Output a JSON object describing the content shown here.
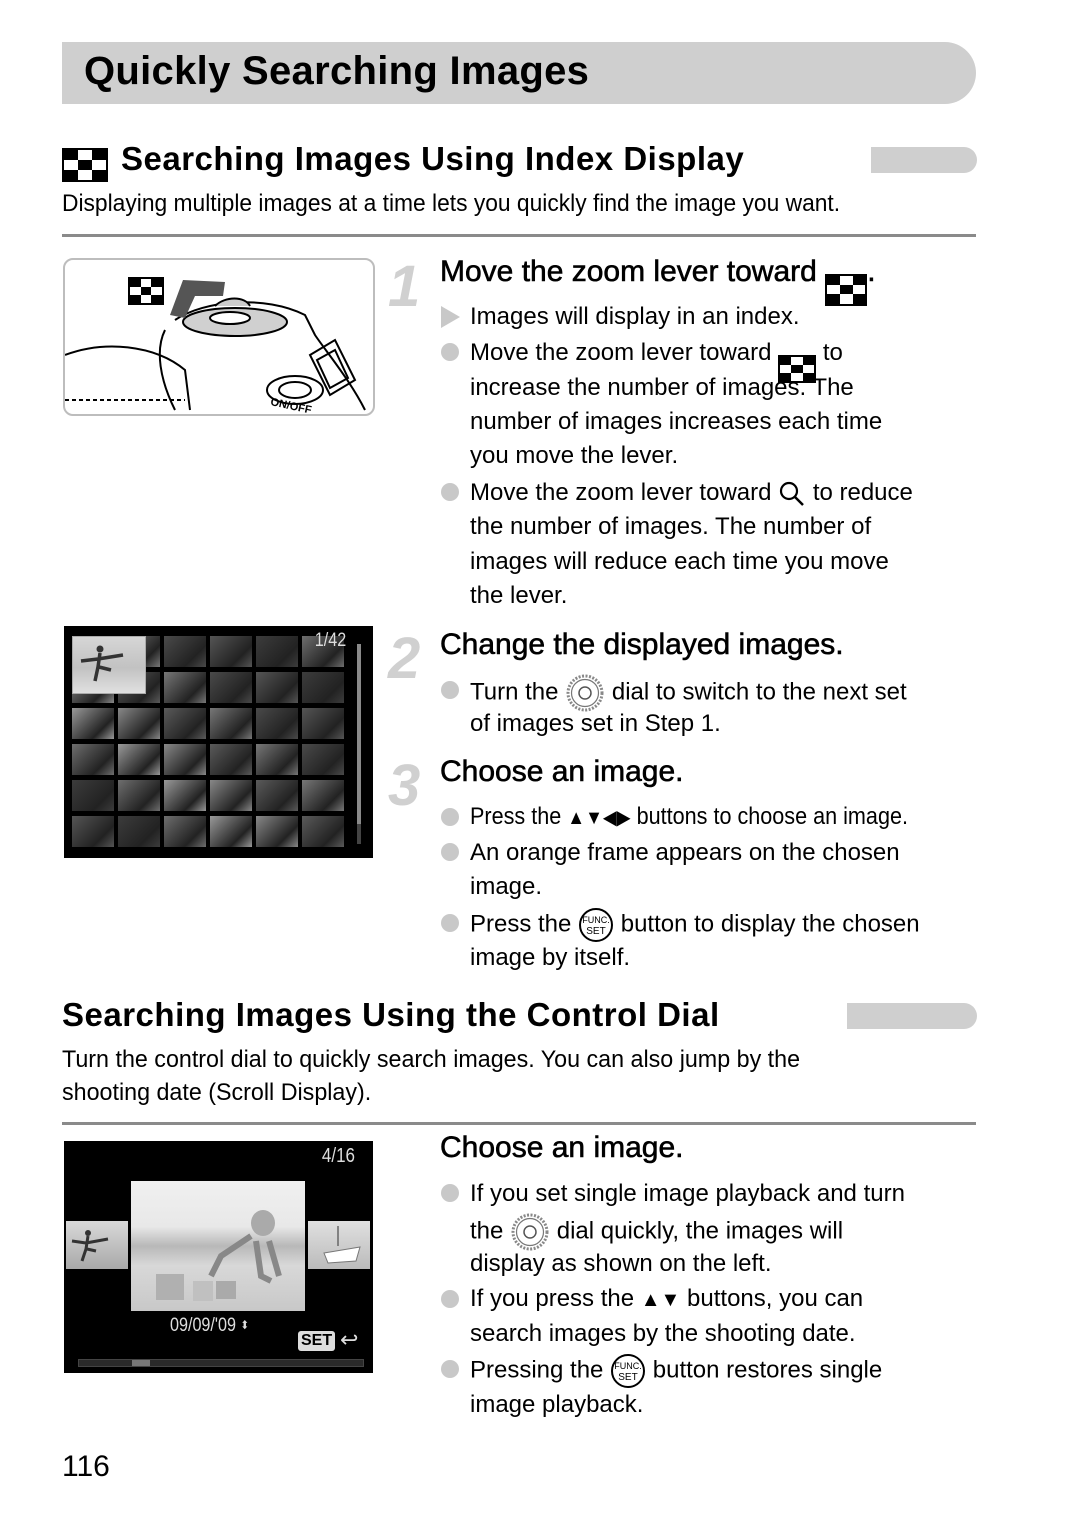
{
  "page": {
    "title": "Quickly Searching Images",
    "page_number": "116"
  },
  "section_index": {
    "icon": "index-display-icon",
    "title": "Searching Images Using Index Display",
    "lead": "Displaying multiple images at a time lets you quickly find the image you want.",
    "steps": [
      {
        "number": "1",
        "title_before": "Move the zoom lever toward",
        "title_icon": "index-display-icon",
        "title_after": ".",
        "items": [
          {
            "marker": "triangle",
            "lines": [
              "Images will display in an index."
            ]
          },
          {
            "marker": "dot",
            "lines": [
              "Move the zoom lever toward",
              "to",
              "increase the number of images. The",
              "number of images increases each time",
              "you move the lever."
            ],
            "icon": "index-display-icon"
          },
          {
            "marker": "dot",
            "lines": [
              "Move the zoom lever toward",
              "to reduce",
              "the number of images. The number of",
              "images will reduce each time you move",
              "the lever."
            ],
            "icon": "magnify-icon"
          }
        ]
      },
      {
        "number": "2",
        "title": "Change the displayed images.",
        "items": [
          {
            "marker": "dot",
            "lines": [
              "Turn the",
              "dial to switch to the next set",
              "of images set in Step 1."
            ],
            "icon": "control-dial-icon"
          }
        ]
      },
      {
        "number": "3",
        "title": "Choose an image.",
        "items": [
          {
            "marker": "dot",
            "lines": [
              "Press the",
              "buttons to choose an image."
            ],
            "icon": "arrow-buttons-up-down-left-right-icon"
          },
          {
            "marker": "dot",
            "lines": [
              "An orange frame appears on the chosen",
              "image."
            ]
          },
          {
            "marker": "dot",
            "lines": [
              "Press the",
              "button to display the chosen",
              "image by itself."
            ],
            "icon": "func-set-button-icon"
          }
        ]
      }
    ],
    "index_screen": {
      "counter": "1/42"
    },
    "camera_illustration": {
      "labels": [
        "ON/OFF"
      ]
    }
  },
  "section_dial": {
    "title": "Searching Images Using the Control Dial",
    "lead_lines": [
      "Turn the control dial to quickly search images. You can also jump by the",
      "shooting date (Scroll Display)."
    ],
    "step": {
      "title": "Choose an image.",
      "items": [
        {
          "marker": "dot",
          "lines": [
            "If you set single image playback and turn",
            "the",
            "dial quickly, the images will",
            "display as shown on the left."
          ],
          "icon": "control-dial-icon"
        },
        {
          "marker": "dot",
          "lines": [
            "If you press the",
            "buttons, you can",
            "search images by the shooting date."
          ],
          "icon": "arrow-buttons-up-down-icon"
        },
        {
          "marker": "dot",
          "lines": [
            "Pressing the",
            "button restores single",
            "image playback."
          ],
          "icon": "func-set-button-icon"
        }
      ]
    },
    "scroll_screen": {
      "counter": "4/16",
      "date": "09/09/'09",
      "set_label": "SET",
      "scroll_position": 0.2
    }
  },
  "glyphs": {
    "func_top": "FUNC.",
    "func_bottom": "SET"
  }
}
